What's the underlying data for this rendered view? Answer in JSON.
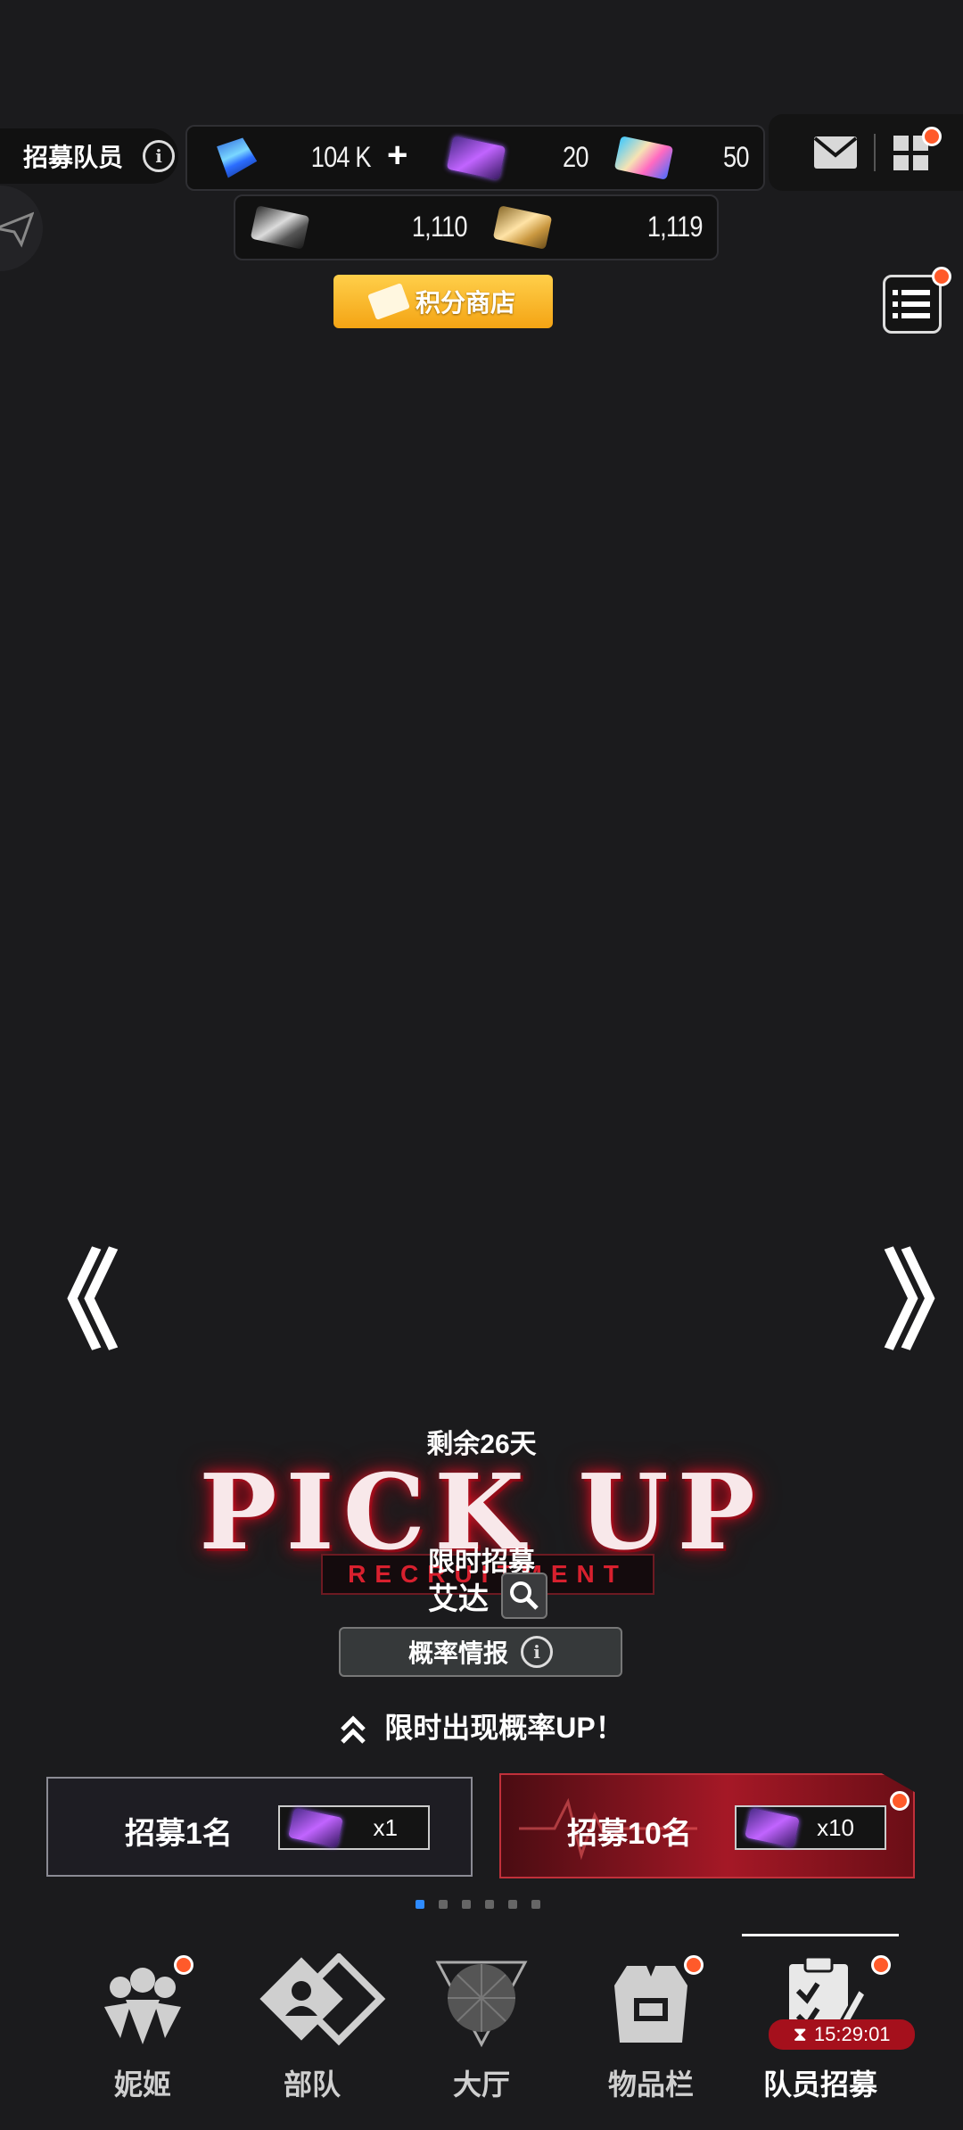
{
  "header": {
    "title": "招募队员",
    "currencies_row1": [
      {
        "icon": "gem-icon",
        "value": "104 K"
      },
      {
        "icon": "purple-ticket-icon",
        "value": "20"
      },
      {
        "icon": "rainbow-ticket-icon",
        "value": "50"
      }
    ],
    "currencies_row2": [
      {
        "icon": "silver-ticket-icon",
        "value": "1,110"
      },
      {
        "icon": "gold-ticket-icon",
        "value": "1,119"
      }
    ],
    "add_symbol": "+",
    "shop_label": "积分商店"
  },
  "nav_arrows": {
    "prev": "《",
    "next": "》"
  },
  "banner": {
    "remaining": "剩余26天",
    "pickup": "PICK UP",
    "recruitment_text": "RECRUITMENT",
    "limited": "限时招募",
    "character": "艾达",
    "prob_label": "概率情报",
    "up_text": "限时出现概率UP！"
  },
  "recruit": {
    "single_label": "招募1名",
    "single_cost": "x1",
    "ten_label": "招募10名",
    "ten_cost": "x10"
  },
  "pager": {
    "count": 6,
    "active": 0
  },
  "bottom_nav": [
    {
      "label": "妮姬",
      "icon": "nikke-icon"
    },
    {
      "label": "部队",
      "icon": "squad-icon"
    },
    {
      "label": "大厅",
      "icon": "lobby-icon"
    },
    {
      "label": "物品栏",
      "icon": "inventory-icon"
    },
    {
      "label": "队员招募",
      "icon": "recruit-icon",
      "timer": "15:29:01"
    }
  ],
  "colors": {
    "accent_red": "#c1303a",
    "shop_gold": "#f4a414",
    "badge": "#ff5a2a",
    "pager_active": "#2e8bff"
  }
}
